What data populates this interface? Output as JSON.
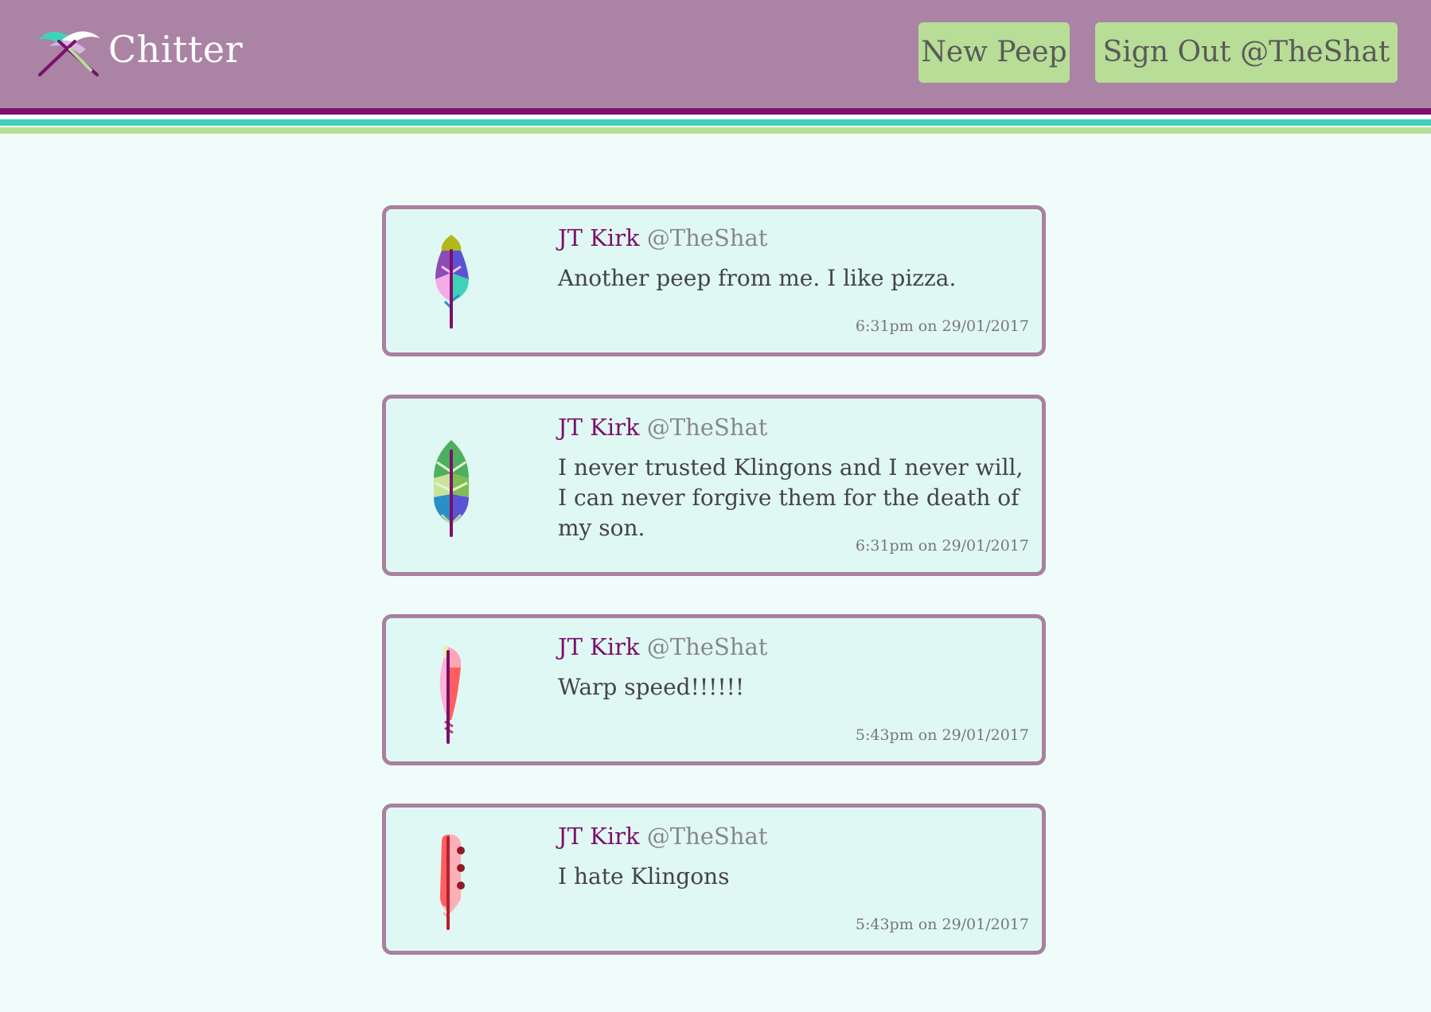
{
  "header": {
    "brand": "Chitter",
    "new_peep_label": "New Peep",
    "sign_out_label": "Sign Out @TheShat"
  },
  "colors": {
    "header_bg": "#ab83a5",
    "button_bg": "#b7dd96",
    "accent_purple": "#7b0f6b",
    "accent_teal": "#3fd2b9",
    "accent_green": "#b7dd96",
    "page_bg": "#effcf9",
    "card_bg": "#e0f8f3",
    "card_border": "#a9809f"
  },
  "peeps": [
    {
      "name": "JT Kirk",
      "handle": "@TheShat",
      "text": "Another peep from me. I like pizza.",
      "time": "6:31pm on 29/01/2017",
      "icon": "feather-multicolor-icon"
    },
    {
      "name": "JT Kirk",
      "handle": "@TheShat",
      "text": "I never trusted Klingons and I never will, I can never forgive them for the death of my son.",
      "time": "6:31pm on 29/01/2017",
      "icon": "feather-green-blue-icon"
    },
    {
      "name": "JT Kirk",
      "handle": "@TheShat",
      "text": "Warp speed!!!!!!",
      "time": "5:43pm on 29/01/2017",
      "icon": "feather-pink-icon"
    },
    {
      "name": "JT Kirk",
      "handle": "@TheShat",
      "text": "I hate Klingons",
      "time": "5:43pm on 29/01/2017",
      "icon": "feather-red-spotted-icon"
    }
  ]
}
